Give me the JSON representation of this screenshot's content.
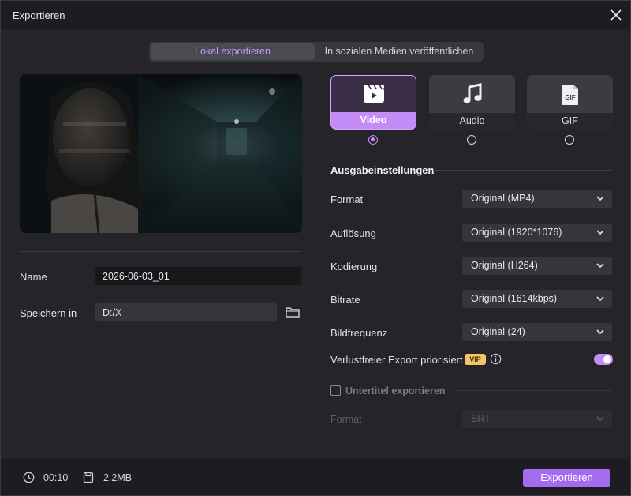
{
  "window": {
    "title": "Exportieren"
  },
  "tabs": {
    "local": "Lokal exportieren",
    "social": "In sozialen Medien veröffentlichen"
  },
  "left": {
    "name_label": "Name",
    "name_value": "2026-06-03_01",
    "save_label": "Speichern in",
    "save_value": "D:/X"
  },
  "modes": [
    {
      "label": "Video",
      "icon": "video-clapper-icon",
      "selected": true
    },
    {
      "label": "Audio",
      "icon": "music-note-icon",
      "selected": false
    },
    {
      "label": "GIF",
      "icon": "gif-file-icon",
      "selected": false,
      "badge": "GIF"
    }
  ],
  "output": {
    "heading": "Ausgabeinstellungen",
    "rows": [
      {
        "label": "Format",
        "value": "Original (MP4)"
      },
      {
        "label": "Auflösung",
        "value": "Original (1920*1076)"
      },
      {
        "label": "Kodierung",
        "value": "Original (H264)"
      },
      {
        "label": "Bitrate",
        "value": "Original (1614kbps)"
      },
      {
        "label": "Bildfrequenz",
        "value": "Original (24)"
      }
    ],
    "lossless_label": "Verlustfreier Export priorisiert",
    "vip_badge": "VIP",
    "lossless_on": true
  },
  "subtitles": {
    "label": "Untertitel exportieren",
    "checked": false,
    "format_label": "Format",
    "format_value": "SRT"
  },
  "footer": {
    "duration": "00:10",
    "size": "2.2MB",
    "export_label": "Exportieren"
  },
  "colors": {
    "accent": "#c38cf7",
    "button": "#a46bf0",
    "vip": "#f3c56b"
  }
}
